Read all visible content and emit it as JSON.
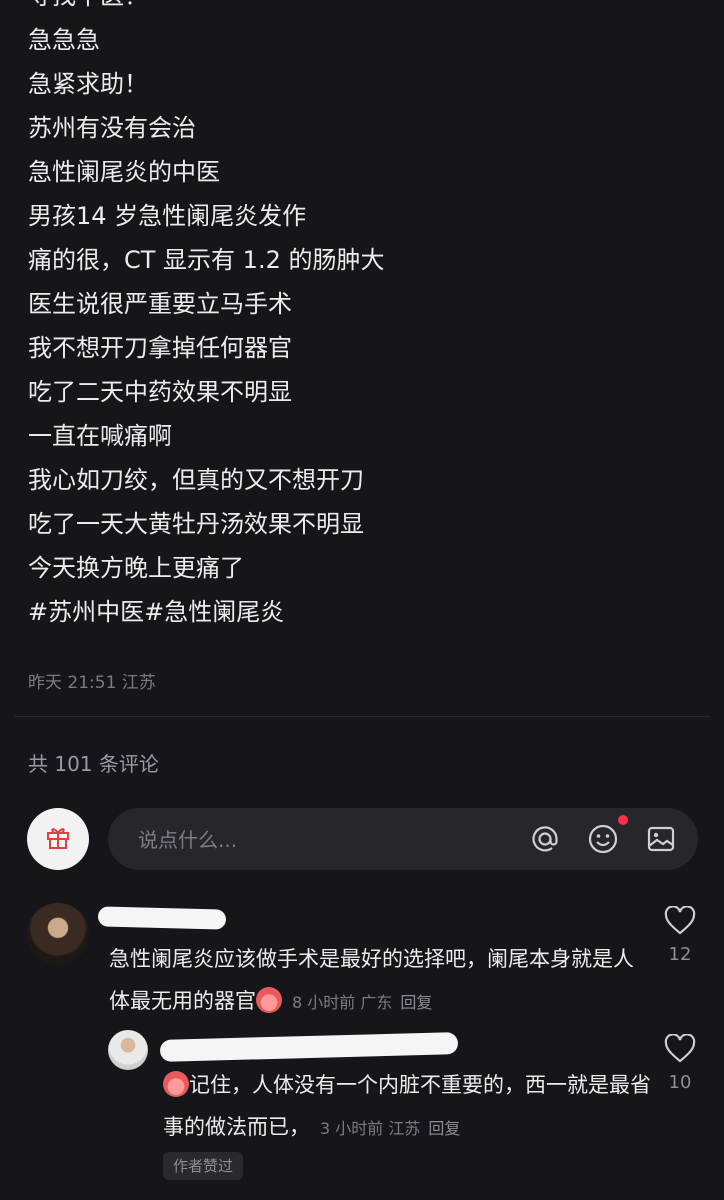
{
  "post": {
    "lines": [
      "寻找中医！",
      "急急急",
      "急紧求助！",
      "苏州有没有会治",
      "急性阑尾炎的中医",
      "男孩14 岁急性阑尾炎发作",
      "痛的很，CT 显示有 1.2 的肠肿大",
      "医生说很严重要立马手术",
      "我不想开刀拿掉任何器官",
      "吃了二天中药效果不明显",
      "一直在喊痛啊",
      "我心如刀绞，但真的又不想开刀",
      "吃了一天大黄牡丹汤效果不明显",
      "今天换方晚上更痛了",
      "#苏州中医#急性阑尾炎"
    ],
    "meta": "昨天 21:51 江苏"
  },
  "comments_count": "共 101 条评论",
  "input": {
    "placeholder": "说点什么..."
  },
  "icons": [
    "gift-icon",
    "at-icon",
    "emoji-icon",
    "image-icon",
    "heart-icon"
  ],
  "comments": [
    {
      "text": "急性阑尾炎应该做手术是最好的选择吧，阑尾本身就是人体最无用的器官",
      "time_loc": "8 小时前 广东",
      "reply_label": "回复",
      "likes": "12"
    },
    {
      "text": "记住，人体没有一个内脏不重要的，西一就是最省事的做法而已，",
      "time_loc": "3 小时前 江苏",
      "reply_label": "回复",
      "likes": "10",
      "badge": "作者赞过"
    }
  ],
  "colors": {
    "background": "#16161a",
    "notification_dot": "#ff2e4d"
  }
}
